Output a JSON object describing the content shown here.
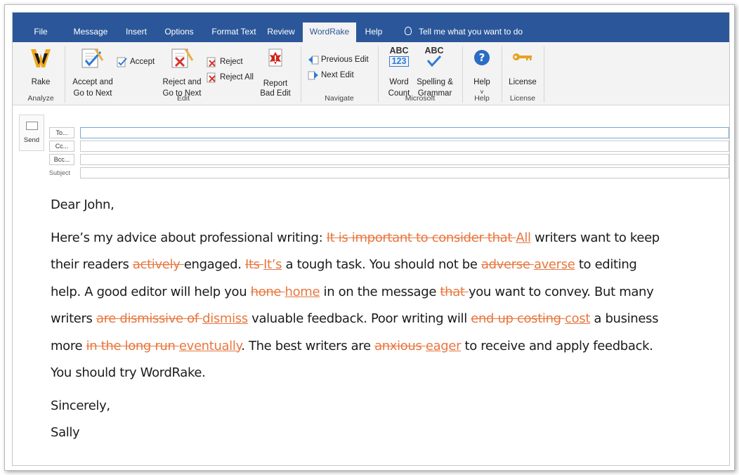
{
  "tabs": [
    {
      "label": "File"
    },
    {
      "label": "Message"
    },
    {
      "label": "Insert"
    },
    {
      "label": "Options"
    },
    {
      "label": "Format Text"
    },
    {
      "label": "Review"
    },
    {
      "label": "WordRake"
    },
    {
      "label": "Help"
    }
  ],
  "tell_me": "Tell me what you want to do",
  "ribbon": {
    "rake": "Rake",
    "accept_go_next_1": "Accept and",
    "accept_go_next_2": "Go to Next",
    "accept": "Accept",
    "reject_go_next_1": "Reject and",
    "reject_go_next_2": "Go to Next",
    "reject": "Reject",
    "reject_all": "Reject All",
    "report_1": "Report",
    "report_2": "Bad Edit",
    "previous_edit": "Previous Edit",
    "next_edit": "Next Edit",
    "word_count_1": "Word",
    "word_count_2": "Count",
    "abc_top": "ABC",
    "abc_num": "123",
    "spelling_1": "Spelling &",
    "spelling_2": "Grammar",
    "help": "Help",
    "help_arrow": "˅",
    "license": "License",
    "groups": {
      "analyze": "Analyze",
      "edit": "Edit",
      "navigate": "Navigate",
      "microsoft": "Microsoft",
      "help": "Help",
      "license": "License"
    }
  },
  "header": {
    "send": "Send",
    "to": "To...",
    "cc": "Cc...",
    "bcc": "Bcc...",
    "subject": "Subject"
  },
  "body": {
    "greeting": "Dear John,",
    "p": [
      {
        "t": "Here’s my advice about professional writing: "
      },
      {
        "t": "It is important to consider that ",
        "del": true
      },
      {
        "t": "All",
        "ins": true
      },
      {
        "t": " writers want to keep their readers "
      },
      {
        "t": "actively ",
        "del": true
      },
      {
        "t": "engaged. "
      },
      {
        "t": "Its ",
        "del": true
      },
      {
        "t": "It’s",
        "ins": true
      },
      {
        "t": " a tough task. You should not be "
      },
      {
        "t": "adverse ",
        "del": true
      },
      {
        "t": "averse",
        "ins": true
      },
      {
        "t": " to editing help. A good editor will help you "
      },
      {
        "t": "hone ",
        "del": true
      },
      {
        "t": "home",
        "ins": true
      },
      {
        "t": " in on the message "
      },
      {
        "t": "that ",
        "del": true
      },
      {
        "t": "you want to convey. But many writers "
      },
      {
        "t": "are dismissive of ",
        "del": true
      },
      {
        "t": "dismiss",
        "ins": true
      },
      {
        "t": " valuable feedback. Poor writing will "
      },
      {
        "t": "end up costing ",
        "del": true
      },
      {
        "t": "cost",
        "ins": true
      },
      {
        "t": " a business more "
      },
      {
        "t": "in the long run ",
        "del": true
      },
      {
        "t": "eventually",
        "ins": true
      },
      {
        "t": ". The best writers are "
      },
      {
        "t": "anxious ",
        "del": true
      },
      {
        "t": "eager",
        "ins": true
      },
      {
        "t": " to receive and apply feedback. You should try WordRake."
      }
    ],
    "closing": "Sincerely,",
    "signature": "Sally"
  },
  "colors": {
    "tab_bar": "#2b579a",
    "ribbon_bg": "#f3f3f3",
    "edit_mark": "#e8773f"
  }
}
